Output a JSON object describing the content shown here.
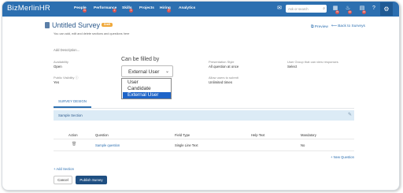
{
  "app": {
    "logo": "BizMerlinHR"
  },
  "nav": [
    {
      "label": "People",
      "badge": "N"
    },
    {
      "label": "Performance",
      "badge": "2"
    },
    {
      "label": "Skills",
      "badge": "3"
    },
    {
      "label": "Projects",
      "badge": ""
    },
    {
      "label": "Hiring",
      "badge": "7"
    },
    {
      "label": "Analytics",
      "badge": ""
    }
  ],
  "search": {
    "placeholder": "Ask or search"
  },
  "top_icons": [
    {
      "name": "mail-icon",
      "glyph": "✉",
      "badge": ""
    },
    {
      "name": "calendar-icon",
      "glyph": "▦",
      "badge": "76"
    },
    {
      "name": "bell-icon",
      "glyph": "🔔",
      "badge": "10"
    },
    {
      "name": "message-icon",
      "glyph": "▤",
      "badge": "15"
    },
    {
      "name": "help-icon",
      "glyph": "?",
      "badge": ""
    }
  ],
  "page": {
    "title": "Untitled Survey",
    "status": "Draft",
    "subtitle": "You can add, edit and delete sections and questions here",
    "preview": "Preview",
    "back": "Back to Surveys",
    "add_description": "Add Description..."
  },
  "fields": {
    "availability_label": "Availability",
    "availability_value": "Open",
    "public_visibility_label": "Public Visibility",
    "public_visibility_value": "Yes",
    "can_be_filled_label": "Can be filled by",
    "can_be_filled_value": "External User",
    "options": [
      "User",
      "Candidate",
      "External User"
    ],
    "presentation_label": "Presentation Style",
    "presentation_value": "All question at once",
    "allow_label": "Allow users to submit",
    "allow_value": "Unlimited times",
    "group_label": "User Group that can view responses",
    "group_value": "Select"
  },
  "tabs": {
    "survey_design": "SURVEY DESIGN"
  },
  "section": {
    "title": "Sample Section",
    "headers": [
      "Action",
      "Question",
      "Field Type",
      "Help Text",
      "Mandatory"
    ],
    "rows": [
      {
        "question": "Sample question",
        "field_type": "Single Line Text",
        "help_text": "",
        "mandatory": "No"
      }
    ],
    "new_question": "+ New Question"
  },
  "footer": {
    "add_section": "+ Add Section",
    "cancel": "Cancel",
    "publish": "Publish Survey"
  }
}
